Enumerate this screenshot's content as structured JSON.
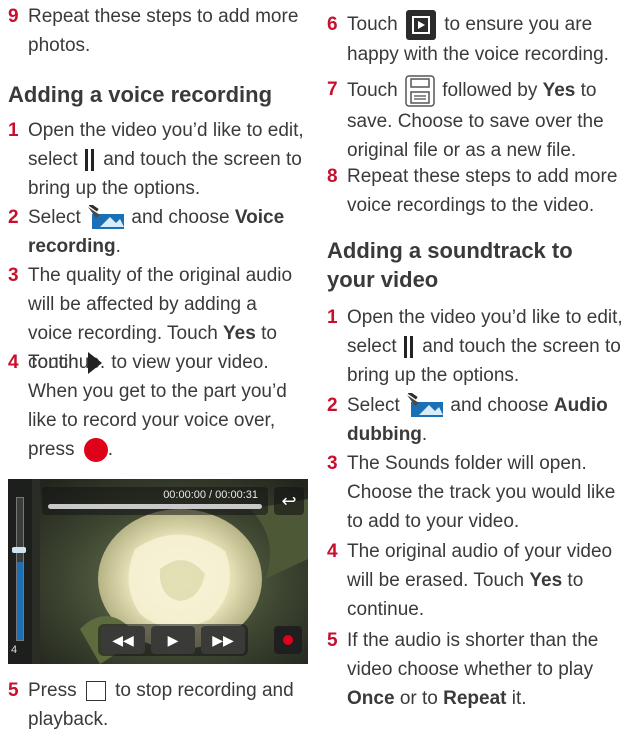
{
  "left": {
    "step9": {
      "num": "9",
      "text": "Repeat these steps to add more photos."
    },
    "heading": "Adding a voice recording",
    "s1": {
      "num": "1",
      "a": "Open the video you’d like to edit, select",
      "b": "and touch the screen to bring up the options."
    },
    "s2": {
      "num": "2",
      "a": "Select",
      "b": "and choose",
      "bold": "Voice recording",
      "c": "."
    },
    "s3": {
      "num": "3",
      "a": "The quality of the original audio will be affected by adding a voice recording. Touch",
      "bold": "Yes",
      "b": "to continue."
    },
    "s4": {
      "num": "4",
      "a": "Touch",
      "b": "to view your video. When you get to the part you’d like to record your voice over, press",
      "c": "."
    },
    "screen": {
      "time": "00:00:00  / 00:00:31",
      "vol": "4"
    },
    "s5": {
      "num": "5",
      "a": "Press",
      "b": "to stop recording and playback."
    }
  },
  "right": {
    "s6": {
      "num": "6",
      "a": "Touch",
      "b": "to ensure you are happy with the voice recording."
    },
    "s7": {
      "num": "7",
      "a": "Touch",
      "b": "followed by",
      "bold": "Yes",
      "c": "to save. Choose to save over the original file or as a new file."
    },
    "s8": {
      "num": "8",
      "text": "Repeat these steps to add more voice recordings to the video."
    },
    "heading": "Adding a soundtrack to your video",
    "s1": {
      "num": "1",
      "a": "Open the video you’d like to edit, select",
      "b": "and touch the screen to bring up the options."
    },
    "s2": {
      "num": "2",
      "a": "Select",
      "b": "and choose",
      "bold": "Audio dubbing",
      "c": "."
    },
    "s3": {
      "num": "3",
      "text": "The Sounds folder will open. Choose the track you would like to add to your video."
    },
    "s4": {
      "num": "4",
      "a": "The original audio of your video will be erased. Touch",
      "bold": "Yes",
      "b": "to continue."
    },
    "s5": {
      "num": "5",
      "a": "If the audio is shorter than the video choose whether to play",
      "bold1": "Once",
      "b": "or to",
      "bold2": "Repeat",
      "c": "it."
    }
  }
}
